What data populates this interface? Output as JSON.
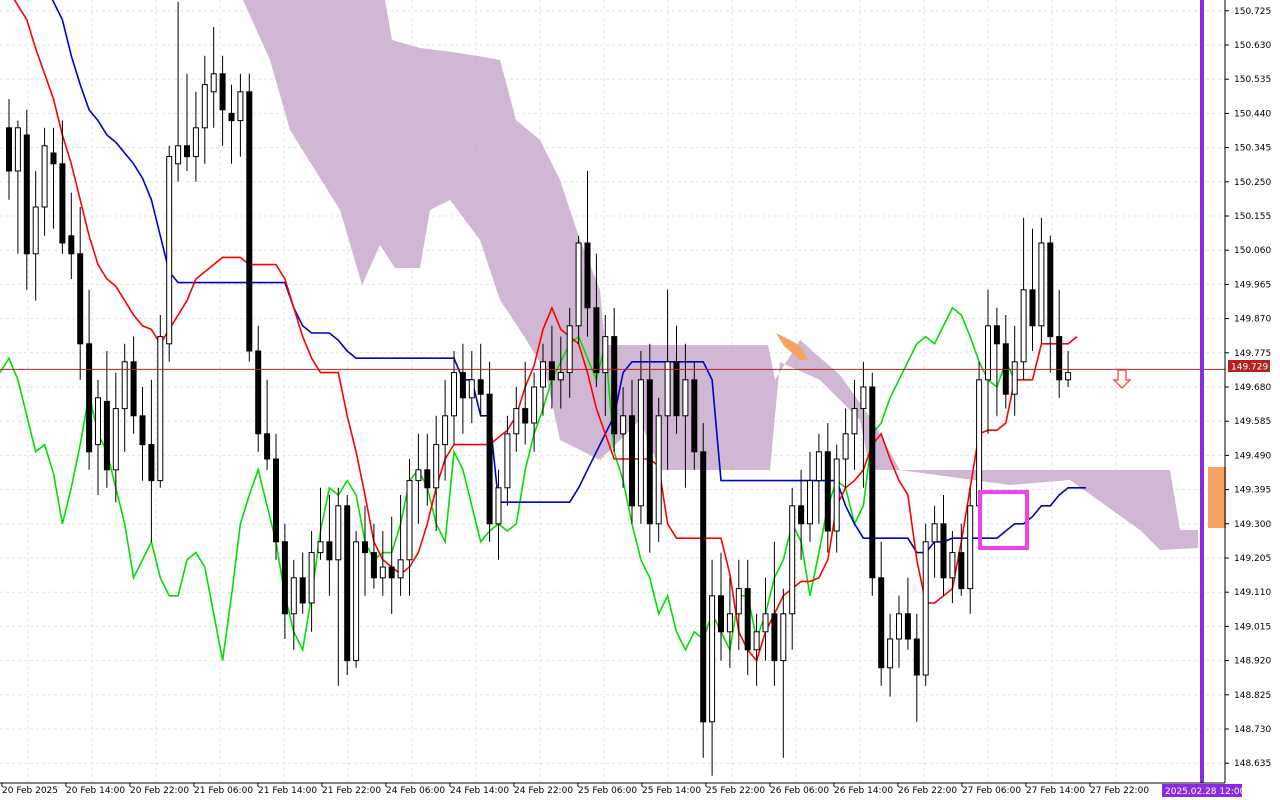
{
  "chart_data": {
    "type": "candlestick",
    "instrument_hint": "USDJPY H2 with Ichimoku Kinko Hyo",
    "y_axis": {
      "min": 148.58,
      "max": 150.755,
      "ticks": [
        "150.725",
        "150.630",
        "150.535",
        "150.440",
        "150.345",
        "150.250",
        "150.155",
        "150.060",
        "149.965",
        "149.870",
        "149.775",
        "149.680",
        "149.585",
        "149.490",
        "149.395",
        "149.300",
        "149.205",
        "149.110",
        "149.015",
        "148.920",
        "148.825",
        "148.730",
        "148.635"
      ]
    },
    "x_axis": {
      "labels": [
        "20 Feb 2025",
        "20 Feb 14:00",
        "20 Feb 22:00",
        "21 Feb 06:00",
        "21 Feb 14:00",
        "21 Feb 22:00",
        "24 Feb 06:00",
        "24 Feb 14:00",
        "24 Feb 22:00",
        "25 Feb 06:00",
        "25 Feb 14:00",
        "25 Feb 22:00",
        "26 Feb 06:00",
        "26 Feb 14:00",
        "26 Feb 22:00",
        "27 Feb 06:00",
        "27 Feb 14:00",
        "27 Feb 22:00"
      ],
      "cursor_time": "2025.02.28 12:00"
    },
    "current_price": "149.729",
    "grid": true,
    "colors": {
      "tenkan": "#ff0000",
      "kijun": "#0000cc",
      "chikou": "#00e000",
      "kumo_bearish": "#c8aacb",
      "kumo_bullish": "#f4a460",
      "price_line": "#b22222",
      "vline": "#8a2be2",
      "highlight_box": "#ee44ee",
      "arrow": "#ff3333",
      "candle": "#000000"
    },
    "candles": [
      {
        "o": 150.4,
        "h": 150.48,
        "l": 150.2,
        "c": 150.28
      },
      {
        "o": 150.28,
        "h": 150.42,
        "l": 150.05,
        "c": 150.4
      },
      {
        "o": 150.38,
        "h": 150.45,
        "l": 149.95,
        "c": 150.05
      },
      {
        "o": 150.05,
        "h": 150.28,
        "l": 149.92,
        "c": 150.18
      },
      {
        "o": 150.18,
        "h": 150.4,
        "l": 150.1,
        "c": 150.35
      },
      {
        "o": 150.33,
        "h": 150.4,
        "l": 150.12,
        "c": 150.3
      },
      {
        "o": 150.3,
        "h": 150.42,
        "l": 150.05,
        "c": 150.08
      },
      {
        "o": 150.1,
        "h": 150.22,
        "l": 149.98,
        "c": 150.05
      },
      {
        "o": 150.05,
        "h": 150.18,
        "l": 149.7,
        "c": 149.8
      },
      {
        "o": 149.8,
        "h": 149.95,
        "l": 149.45,
        "c": 149.5
      },
      {
        "o": 149.52,
        "h": 149.7,
        "l": 149.38,
        "c": 149.65
      },
      {
        "o": 149.64,
        "h": 149.78,
        "l": 149.4,
        "c": 149.45
      },
      {
        "o": 149.45,
        "h": 149.72,
        "l": 149.36,
        "c": 149.62
      },
      {
        "o": 149.62,
        "h": 149.8,
        "l": 149.5,
        "c": 149.75
      },
      {
        "o": 149.75,
        "h": 149.82,
        "l": 149.55,
        "c": 149.6
      },
      {
        "o": 149.6,
        "h": 149.68,
        "l": 149.42,
        "c": 149.52
      },
      {
        "o": 149.52,
        "h": 149.7,
        "l": 149.25,
        "c": 149.42
      },
      {
        "o": 149.42,
        "h": 149.88,
        "l": 149.4,
        "c": 149.82
      },
      {
        "o": 149.8,
        "h": 150.35,
        "l": 149.75,
        "c": 150.32
      },
      {
        "o": 150.3,
        "h": 150.75,
        "l": 150.25,
        "c": 150.35
      },
      {
        "o": 150.35,
        "h": 150.55,
        "l": 150.28,
        "c": 150.32
      },
      {
        "o": 150.32,
        "h": 150.5,
        "l": 150.25,
        "c": 150.4
      },
      {
        "o": 150.4,
        "h": 150.6,
        "l": 150.3,
        "c": 150.52
      },
      {
        "o": 150.5,
        "h": 150.68,
        "l": 150.4,
        "c": 150.55
      },
      {
        "o": 150.55,
        "h": 150.6,
        "l": 150.35,
        "c": 150.45
      },
      {
        "o": 150.44,
        "h": 150.52,
        "l": 150.3,
        "c": 150.42
      },
      {
        "o": 150.42,
        "h": 150.55,
        "l": 150.32,
        "c": 150.5
      },
      {
        "o": 150.5,
        "h": 150.55,
        "l": 149.75,
        "c": 149.78
      },
      {
        "o": 149.78,
        "h": 149.85,
        "l": 149.5,
        "c": 149.55
      },
      {
        "o": 149.55,
        "h": 149.7,
        "l": 149.45,
        "c": 149.48
      },
      {
        "o": 149.48,
        "h": 149.55,
        "l": 149.2,
        "c": 149.25
      },
      {
        "o": 149.25,
        "h": 149.3,
        "l": 148.98,
        "c": 149.05
      },
      {
        "o": 149.05,
        "h": 149.2,
        "l": 148.95,
        "c": 149.15
      },
      {
        "o": 149.15,
        "h": 149.22,
        "l": 149.05,
        "c": 149.08
      },
      {
        "o": 149.08,
        "h": 149.28,
        "l": 149.0,
        "c": 149.22
      },
      {
        "o": 149.22,
        "h": 149.4,
        "l": 149.2,
        "c": 149.25
      },
      {
        "o": 149.25,
        "h": 149.38,
        "l": 149.1,
        "c": 149.2
      },
      {
        "o": 149.2,
        "h": 149.4,
        "l": 148.85,
        "c": 149.35
      },
      {
        "o": 149.35,
        "h": 149.38,
        "l": 148.88,
        "c": 148.92
      },
      {
        "o": 148.92,
        "h": 149.28,
        "l": 148.9,
        "c": 149.25
      },
      {
        "o": 149.25,
        "h": 149.35,
        "l": 149.1,
        "c": 149.22
      },
      {
        "o": 149.22,
        "h": 149.3,
        "l": 149.12,
        "c": 149.15
      },
      {
        "o": 149.15,
        "h": 149.28,
        "l": 149.1,
        "c": 149.18
      },
      {
        "o": 149.18,
        "h": 149.32,
        "l": 149.05,
        "c": 149.15
      },
      {
        "o": 149.15,
        "h": 149.38,
        "l": 149.1,
        "c": 149.2
      },
      {
        "o": 149.2,
        "h": 149.48,
        "l": 149.1,
        "c": 149.42
      },
      {
        "o": 149.42,
        "h": 149.55,
        "l": 149.3,
        "c": 149.45
      },
      {
        "o": 149.45,
        "h": 149.55,
        "l": 149.35,
        "c": 149.4
      },
      {
        "o": 149.4,
        "h": 149.6,
        "l": 149.28,
        "c": 149.52
      },
      {
        "o": 149.52,
        "h": 149.7,
        "l": 149.42,
        "c": 149.6
      },
      {
        "o": 149.6,
        "h": 149.78,
        "l": 149.52,
        "c": 149.72
      },
      {
        "o": 149.72,
        "h": 149.8,
        "l": 149.55,
        "c": 149.65
      },
      {
        "o": 149.65,
        "h": 149.78,
        "l": 149.58,
        "c": 149.7
      },
      {
        "o": 149.7,
        "h": 149.8,
        "l": 149.6,
        "c": 149.66
      },
      {
        "o": 149.66,
        "h": 149.75,
        "l": 149.25,
        "c": 149.3
      },
      {
        "o": 149.3,
        "h": 149.45,
        "l": 149.2,
        "c": 149.4
      },
      {
        "o": 149.4,
        "h": 149.6,
        "l": 149.35,
        "c": 149.55
      },
      {
        "o": 149.55,
        "h": 149.68,
        "l": 149.5,
        "c": 149.62
      },
      {
        "o": 149.62,
        "h": 149.75,
        "l": 149.52,
        "c": 149.58
      },
      {
        "o": 149.58,
        "h": 149.72,
        "l": 149.5,
        "c": 149.68
      },
      {
        "o": 149.68,
        "h": 149.8,
        "l": 149.6,
        "c": 149.75
      },
      {
        "o": 149.75,
        "h": 149.85,
        "l": 149.62,
        "c": 149.7
      },
      {
        "o": 149.7,
        "h": 149.82,
        "l": 149.62,
        "c": 149.72
      },
      {
        "o": 149.72,
        "h": 149.9,
        "l": 149.65,
        "c": 149.85
      },
      {
        "o": 149.85,
        "h": 150.1,
        "l": 149.8,
        "c": 150.08
      },
      {
        "o": 150.08,
        "h": 150.28,
        "l": 149.82,
        "c": 149.9
      },
      {
        "o": 149.9,
        "h": 150.05,
        "l": 149.68,
        "c": 149.72
      },
      {
        "o": 149.72,
        "h": 149.88,
        "l": 149.6,
        "c": 149.82
      },
      {
        "o": 149.82,
        "h": 149.9,
        "l": 149.5,
        "c": 149.55
      },
      {
        "o": 149.55,
        "h": 149.68,
        "l": 149.4,
        "c": 149.6
      },
      {
        "o": 149.6,
        "h": 149.7,
        "l": 149.3,
        "c": 149.35
      },
      {
        "o": 149.35,
        "h": 149.78,
        "l": 149.3,
        "c": 149.7
      },
      {
        "o": 149.7,
        "h": 149.8,
        "l": 149.22,
        "c": 149.3
      },
      {
        "o": 149.3,
        "h": 149.65,
        "l": 149.25,
        "c": 149.6
      },
      {
        "o": 149.6,
        "h": 149.95,
        "l": 149.45,
        "c": 149.75
      },
      {
        "o": 149.75,
        "h": 149.85,
        "l": 149.55,
        "c": 149.6
      },
      {
        "o": 149.6,
        "h": 149.8,
        "l": 149.4,
        "c": 149.7
      },
      {
        "o": 149.7,
        "h": 149.75,
        "l": 149.45,
        "c": 149.5
      },
      {
        "o": 149.5,
        "h": 149.58,
        "l": 148.65,
        "c": 148.75
      },
      {
        "o": 148.75,
        "h": 149.2,
        "l": 148.6,
        "c": 149.1
      },
      {
        "o": 149.1,
        "h": 149.22,
        "l": 148.92,
        "c": 149.0
      },
      {
        "o": 149.0,
        "h": 149.15,
        "l": 148.9,
        "c": 149.05
      },
      {
        "o": 149.05,
        "h": 149.2,
        "l": 148.95,
        "c": 149.12
      },
      {
        "o": 149.12,
        "h": 149.2,
        "l": 148.88,
        "c": 148.95
      },
      {
        "o": 148.95,
        "h": 149.05,
        "l": 148.85,
        "c": 149.0
      },
      {
        "o": 149.0,
        "h": 149.15,
        "l": 148.92,
        "c": 149.05
      },
      {
        "o": 149.05,
        "h": 149.25,
        "l": 148.85,
        "c": 148.92
      },
      {
        "o": 148.92,
        "h": 149.12,
        "l": 148.65,
        "c": 149.05
      },
      {
        "o": 149.05,
        "h": 149.4,
        "l": 148.95,
        "c": 149.35
      },
      {
        "o": 149.35,
        "h": 149.45,
        "l": 149.2,
        "c": 149.3
      },
      {
        "o": 149.3,
        "h": 149.5,
        "l": 149.25,
        "c": 149.42
      },
      {
        "o": 149.42,
        "h": 149.55,
        "l": 149.3,
        "c": 149.5
      },
      {
        "o": 149.5,
        "h": 149.58,
        "l": 149.22,
        "c": 149.28
      },
      {
        "o": 149.28,
        "h": 149.52,
        "l": 149.22,
        "c": 149.48
      },
      {
        "o": 149.48,
        "h": 149.62,
        "l": 149.4,
        "c": 149.55
      },
      {
        "o": 149.55,
        "h": 149.7,
        "l": 149.45,
        "c": 149.62
      },
      {
        "o": 149.62,
        "h": 149.75,
        "l": 149.4,
        "c": 149.68
      },
      {
        "o": 149.68,
        "h": 149.72,
        "l": 149.1,
        "c": 149.15
      },
      {
        "o": 149.15,
        "h": 149.25,
        "l": 148.85,
        "c": 148.9
      },
      {
        "o": 148.9,
        "h": 149.05,
        "l": 148.82,
        "c": 148.98
      },
      {
        "o": 148.98,
        "h": 149.1,
        "l": 148.9,
        "c": 149.05
      },
      {
        "o": 149.05,
        "h": 149.15,
        "l": 148.95,
        "c": 148.98
      },
      {
        "o": 148.98,
        "h": 149.05,
        "l": 148.75,
        "c": 148.88
      },
      {
        "o": 148.88,
        "h": 149.3,
        "l": 148.85,
        "c": 149.25
      },
      {
        "o": 149.25,
        "h": 149.35,
        "l": 149.15,
        "c": 149.3
      },
      {
        "o": 149.3,
        "h": 149.38,
        "l": 149.1,
        "c": 149.15
      },
      {
        "o": 149.15,
        "h": 149.28,
        "l": 149.08,
        "c": 149.22
      },
      {
        "o": 149.22,
        "h": 149.3,
        "l": 149.1,
        "c": 149.12
      },
      {
        "o": 149.12,
        "h": 149.4,
        "l": 149.05,
        "c": 149.35
      },
      {
        "o": 149.35,
        "h": 149.75,
        "l": 149.3,
        "c": 149.7
      },
      {
        "o": 149.7,
        "h": 149.95,
        "l": 149.55,
        "c": 149.85
      },
      {
        "o": 149.85,
        "h": 149.9,
        "l": 149.6,
        "c": 149.8
      },
      {
        "o": 149.8,
        "h": 149.88,
        "l": 149.62,
        "c": 149.66
      },
      {
        "o": 149.66,
        "h": 149.85,
        "l": 149.6,
        "c": 149.75
      },
      {
        "o": 149.75,
        "h": 150.15,
        "l": 149.7,
        "c": 149.95
      },
      {
        "o": 149.95,
        "h": 150.12,
        "l": 149.78,
        "c": 149.85
      },
      {
        "o": 149.85,
        "h": 150.15,
        "l": 149.8,
        "c": 150.08
      },
      {
        "o": 150.08,
        "h": 150.1,
        "l": 149.72,
        "c": 149.82
      },
      {
        "o": 149.82,
        "h": 149.95,
        "l": 149.65,
        "c": 149.7
      },
      {
        "o": 149.7,
        "h": 149.78,
        "l": 149.68,
        "c": 149.72
      }
    ],
    "tenkan": [
      150.78,
      150.74,
      150.7,
      150.62,
      150.55,
      150.48,
      150.38,
      150.3,
      150.2,
      150.1,
      150.02,
      149.98,
      149.96,
      149.92,
      149.88,
      149.85,
      149.84,
      149.8,
      149.84,
      149.88,
      149.92,
      149.98,
      150.0,
      150.02,
      150.04,
      150.04,
      150.04,
      150.02,
      150.02,
      150.02,
      150.02,
      149.98,
      149.9,
      149.82,
      149.76,
      149.72,
      149.72,
      149.72,
      149.6,
      149.5,
      149.38,
      149.25,
      149.2,
      149.18,
      149.16,
      149.18,
      149.22,
      149.3,
      149.4,
      149.48,
      149.52,
      149.52,
      149.52,
      149.52,
      149.52,
      149.54,
      149.56,
      149.6,
      149.68,
      149.74,
      149.84,
      149.9,
      149.84,
      149.82,
      149.8,
      149.72,
      149.62,
      149.55,
      149.48,
      149.48,
      149.48,
      149.48,
      149.48,
      149.46,
      149.3,
      149.26,
      149.26,
      149.26,
      149.26,
      149.26,
      149.26,
      149.16,
      149.0,
      148.95,
      148.92,
      149.0,
      149.05,
      149.1,
      149.12,
      149.14,
      149.14,
      149.15,
      149.2,
      149.35,
      149.4,
      149.42,
      149.45,
      149.52,
      149.55,
      149.48,
      149.42,
      149.38,
      149.2,
      149.08,
      149.08,
      149.1,
      149.12,
      149.25,
      149.4,
      149.55,
      149.56,
      149.56,
      149.58,
      149.7,
      149.7,
      149.7,
      149.8,
      149.8,
      149.8,
      149.8,
      149.82
    ],
    "kijun": [
      150.9,
      150.9,
      150.9,
      150.85,
      150.8,
      150.75,
      150.7,
      150.6,
      150.52,
      150.45,
      150.42,
      150.38,
      150.36,
      150.33,
      150.3,
      150.26,
      150.2,
      150.1,
      150.0,
      149.97,
      149.97,
      149.97,
      149.97,
      149.97,
      149.97,
      149.97,
      149.97,
      149.97,
      149.97,
      149.97,
      149.97,
      149.97,
      149.9,
      149.85,
      149.83,
      149.83,
      149.83,
      149.81,
      149.78,
      149.76,
      149.76,
      149.76,
      149.76,
      149.76,
      149.76,
      149.76,
      149.76,
      149.76,
      149.76,
      149.76,
      149.76,
      149.7,
      149.7,
      149.6,
      149.6,
      149.36,
      149.36,
      149.36,
      149.36,
      149.36,
      149.36,
      149.36,
      149.36,
      149.36,
      149.4,
      149.45,
      149.5,
      149.55,
      149.6,
      149.72,
      149.75,
      149.75,
      149.75,
      149.75,
      149.75,
      149.75,
      149.75,
      149.75,
      149.75,
      149.7,
      149.42,
      149.42,
      149.42,
      149.42,
      149.42,
      149.42,
      149.42,
      149.42,
      149.42,
      149.42,
      149.42,
      149.42,
      149.42,
      149.42,
      149.35,
      149.3,
      149.26,
      149.26,
      149.26,
      149.26,
      149.26,
      149.26,
      149.22,
      149.22,
      149.25,
      149.25,
      149.26,
      149.26,
      149.26,
      149.26,
      149.26,
      149.26,
      149.28,
      149.3,
      149.3,
      149.32,
      149.35,
      149.35,
      149.38,
      149.4,
      149.4,
      149.4
    ],
    "chikou": [
      149.72,
      149.76,
      149.7,
      149.6,
      149.5,
      149.52,
      149.44,
      149.3,
      149.4,
      149.52,
      149.66,
      149.55,
      149.5,
      149.4,
      149.3,
      149.15,
      149.2,
      149.25,
      149.15,
      149.1,
      149.1,
      149.2,
      149.22,
      149.18,
      149.05,
      148.92,
      149.1,
      149.3,
      149.38,
      149.45,
      149.35,
      149.25,
      149.1,
      149.0,
      148.95,
      149.1,
      149.28,
      149.4,
      149.38,
      149.42,
      149.38,
      149.25,
      149.2,
      149.22,
      149.22,
      149.3,
      149.42,
      149.45,
      149.4,
      149.3,
      149.25,
      149.5,
      149.45,
      149.35,
      149.25,
      149.28,
      149.3,
      149.28,
      149.3,
      149.45,
      149.55,
      149.62,
      149.7,
      149.75,
      149.8,
      149.82,
      149.76,
      149.7,
      149.8,
      149.5,
      149.42,
      149.3,
      149.2,
      149.15,
      149.05,
      149.1,
      149.0,
      148.95,
      149.0,
      148.98,
      149.05,
      149.0,
      148.95,
      149.1,
      149.1,
      148.98,
      149.05,
      149.15,
      149.2,
      149.3,
      149.25,
      149.1,
      149.22,
      149.35,
      149.42,
      149.4,
      149.3,
      149.35,
      149.55,
      149.58,
      149.65,
      149.7,
      149.75,
      149.8,
      149.82,
      149.8,
      149.85,
      149.9,
      149.88,
      149.82,
      149.75,
      149.7,
      149.68,
      149.75,
      149.7
    ]
  },
  "labels": {
    "price_tag": "149.729",
    "time_tag": "2025.02.28 12:00"
  }
}
